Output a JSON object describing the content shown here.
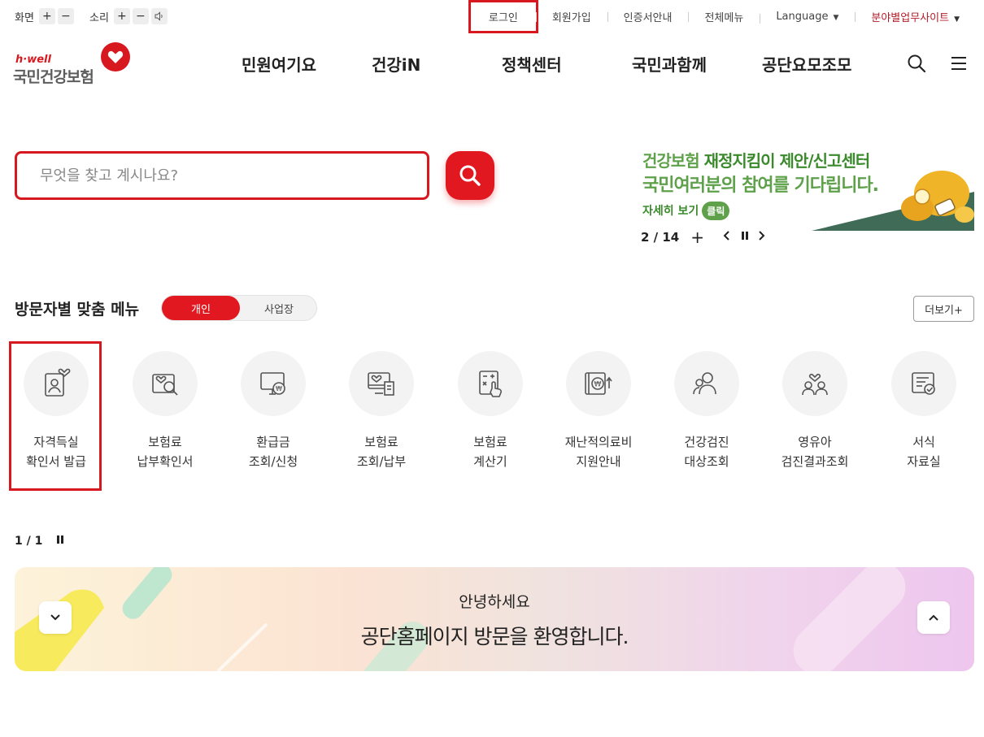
{
  "utility": {
    "screen_label": "화면",
    "sound_label": "소리",
    "plus": "+",
    "minus": "−"
  },
  "top_links": {
    "login": "로그인",
    "signup": "회원가입",
    "cert": "인증서안내",
    "all_menu": "전체메뉴",
    "language": "Language",
    "sites": "분야별업무사이트"
  },
  "logo": {
    "hwell": "h·well",
    "name": "국민건강보험"
  },
  "gnb": [
    "민원여기요",
    "건강iN",
    "정책센터",
    "국민과함께",
    "공단요모조모"
  ],
  "search": {
    "placeholder": "무엇을 찾고 계시나요?"
  },
  "banner": {
    "line1_a": "건강보험 ",
    "line1_b": "재정지킴이 제안/신고센터",
    "line2": "국민여러분의 참여를 기다립니다.",
    "detail": "자세히 보기",
    "click": "클릭",
    "page_current": "2",
    "page_sep": " / ",
    "page_total": "14",
    "plus": "+"
  },
  "visitor_menu": {
    "title": "방문자별 맞춤 메뉴",
    "tab_personal": "개인",
    "tab_business": "사업장",
    "more": "더보기+",
    "items": [
      {
        "line1": "자격득실",
        "line2": "확인서 발급",
        "icon": "id-card-heart-icon"
      },
      {
        "line1": "보험료",
        "line2": "납부확인서",
        "icon": "search-heart-icon"
      },
      {
        "line1": "환급금",
        "line2": "조회/신청",
        "icon": "monitor-won-icon"
      },
      {
        "line1": "보험료",
        "line2": "조회/납부",
        "icon": "monitor-receipt-icon"
      },
      {
        "line1": "보험료",
        "line2": "계산기",
        "icon": "calculator-icon"
      },
      {
        "line1": "재난적의료비",
        "line2": "지원안내",
        "icon": "won-arrow-icon"
      },
      {
        "line1": "건강검진",
        "line2": "대상조회",
        "icon": "people-icon"
      },
      {
        "line1": "영유아",
        "line2": "검진결과조회",
        "icon": "family-heart-icon"
      },
      {
        "line1": "서식",
        "line2": "자료실",
        "icon": "document-check-icon"
      }
    ],
    "pager_current": "1",
    "pager_sep": " / ",
    "pager_total": "1"
  },
  "welcome": {
    "hello": "안녕하세요",
    "message": "공단홈페이지 방문을 환영합니다."
  },
  "colors": {
    "brand_red": "#e21820",
    "banner_green": "#5ea14a"
  }
}
